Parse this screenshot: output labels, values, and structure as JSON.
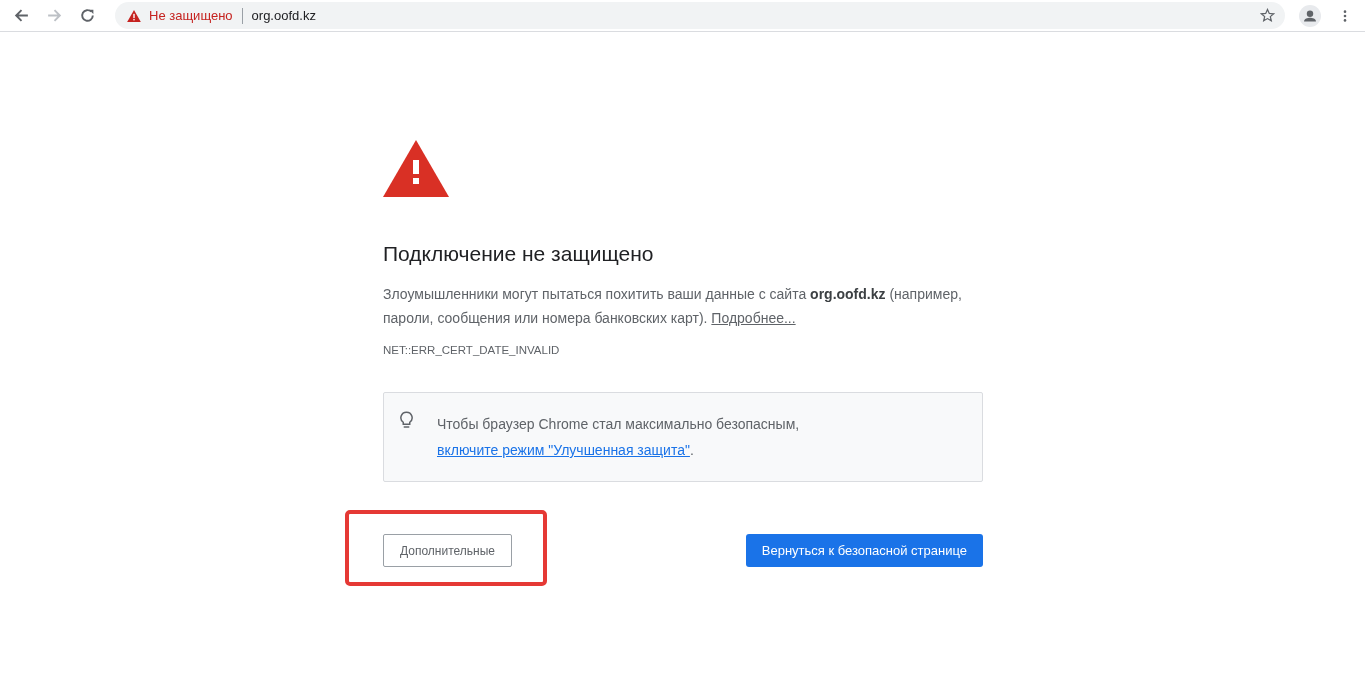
{
  "toolbar": {
    "security_label": "Не защищено",
    "url": "org.oofd.kz"
  },
  "page": {
    "title": "Подключение не защищено",
    "message": "Злоумышленники могут пытаться похитить ваши данные с сайта **org.oofd.kz** (например, пароли, сообщения или номера банковских карт). ",
    "message_link": "Подробнее...",
    "error_code": "NET::ERR_CERT_DATE_INVALID",
    "tip": "Чтобы браузер Chrome стал максимально безопасным, ",
    "tip_link": "включите режим \"Улучшенная защита\"",
    "tip_end": ".",
    "advanced_button": "Дополнительные",
    "back_button": "Вернуться к безопасной странице"
  }
}
